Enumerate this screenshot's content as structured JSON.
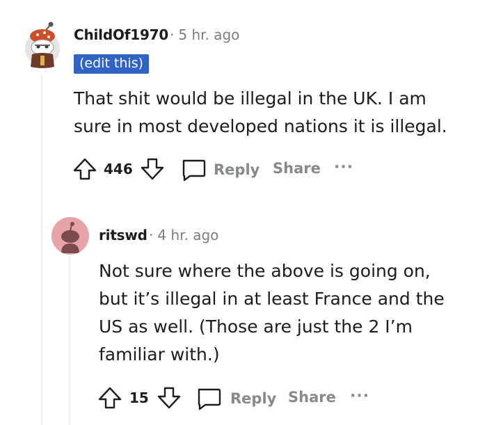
{
  "comments": [
    {
      "username": "ChildOf1970",
      "separator": "·",
      "timestamp": "5 hr. ago",
      "badge": "(edit this)",
      "lines": [
        "That shit would be illegal in the UK. I am",
        "sure in most developed nations it is illegal."
      ],
      "votes": "446",
      "reply_label": "Reply",
      "share_label": "Share",
      "more_label": "···"
    },
    {
      "username": "ritswd",
      "separator": "·",
      "timestamp": "4 hr. ago",
      "lines": [
        "Not sure where the above is going on,",
        "but it’s illegal in at least France and the",
        "US as well. (Those are just the 2 I’m",
        "familiar with.)"
      ],
      "votes": "15",
      "reply_label": "Reply",
      "share_label": "Share",
      "more_label": "···"
    }
  ],
  "colors": {
    "text": "#1c1c1c",
    "meta": "#7c7c7c",
    "action": "#878a8c",
    "badge_bg": "#2f63c6",
    "thread_line": "#ededed",
    "avatar2_bg": "#e8a3a8"
  },
  "icons": [
    "upvote-icon",
    "downvote-icon",
    "comment-icon",
    "more-icon"
  ]
}
